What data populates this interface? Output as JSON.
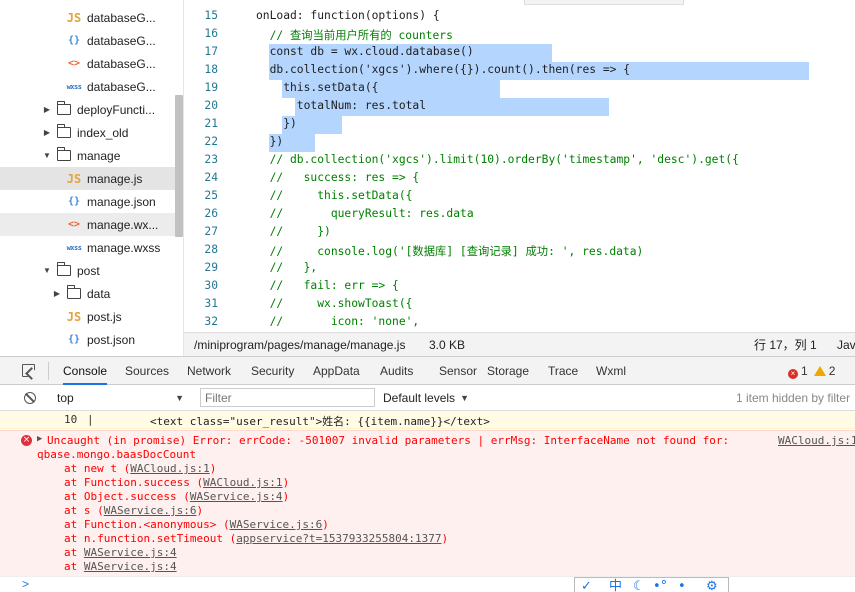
{
  "file_tree": {
    "items": [
      {
        "type": "js",
        "icon": "js-file-icon",
        "label": "databaseG..."
      },
      {
        "type": "json",
        "icon": "json-file-icon",
        "label": "databaseG..."
      },
      {
        "type": "wxml",
        "icon": "wxml-file-icon",
        "label": "databaseG..."
      },
      {
        "type": "wxss",
        "icon": "wxss-file-icon",
        "label": "databaseG..."
      },
      {
        "type": "folder",
        "state": "collapsed",
        "label": "deployFuncti..."
      },
      {
        "type": "folder",
        "state": "collapsed",
        "label": "index_old"
      },
      {
        "type": "folder",
        "state": "expanded",
        "label": "manage"
      },
      {
        "type": "js",
        "icon": "js-file-icon",
        "label": "manage.js",
        "selected": true
      },
      {
        "type": "json",
        "icon": "json-file-icon",
        "label": "manage.json"
      },
      {
        "type": "wxml",
        "icon": "wxml-file-icon",
        "label": "manage.wx..."
      },
      {
        "type": "wxss",
        "icon": "wxss-file-icon",
        "label": "manage.wxss"
      },
      {
        "type": "folder",
        "state": "expanded",
        "label": "post"
      },
      {
        "type": "folder",
        "state": "collapsed",
        "label": "data"
      },
      {
        "type": "js",
        "icon": "js-file-icon",
        "label": "post.js"
      },
      {
        "type": "json",
        "icon": "json-file-icon",
        "label": "post.json"
      }
    ],
    "icon_glyphs": {
      "js": "JS",
      "json": "{}",
      "wxml": "<>",
      "wxss": "wxss"
    }
  },
  "editor": {
    "line_numbers": [
      "15",
      "16",
      "17",
      "18",
      "19",
      "20",
      "21",
      "22",
      "23",
      "24",
      "25",
      "26",
      "27",
      "28",
      "29",
      "30",
      "31",
      "32"
    ],
    "lines": [
      "onLoad: function(options) {",
      "  // 查询当前用户所有的 counters",
      "  const db = wx.cloud.database()",
      "  db.collection('xgcs').where({}).count().then(res => {",
      "    this.setData({",
      "      totalNum: res.total",
      "    })",
      "  })",
      "  // db.collection('xgcs').limit(10).orderBy('timestamp', 'desc').get({",
      "  //   success: res => {",
      "  //     this.setData({",
      "  //       queryResult: res.data",
      "  //     })",
      "  //     console.log('[数据库] [查询记录] 成功: ', res.data)",
      "  //   },",
      "  //   fail: err => {",
      "  //     wx.showToast({",
      "  //       icon: 'none',"
    ]
  },
  "statusbar": {
    "path": "/miniprogram/pages/manage/manage.js",
    "size": "3.0 KB",
    "cursor": "行 17，列 1",
    "language": "Jav"
  },
  "devtools": {
    "tabs": [
      "Console",
      "Sources",
      "Network",
      "Security",
      "AppData",
      "Audits",
      "Sensor",
      "Storage",
      "Trace",
      "Wxml"
    ],
    "active_tab": "Console",
    "error_count": "1",
    "warning_count": "2",
    "context": "top",
    "filter_placeholder": "Filter",
    "levels": "Default levels",
    "hidden_info": "1 item hidden by filter",
    "log": {
      "line_number": "10",
      "separator": "|",
      "text": "<text class=\"user_result\">姓名: {{item.name}}</text>"
    },
    "error": {
      "message_line1": "Uncaught (in promise) Error: errCode: -501007 invalid parameters | errMsg: InterfaceName not found for:",
      "message_line2": "qbase.mongo.baasDocCount",
      "source": "WACloud.js:1",
      "stack": [
        {
          "prefix": "at new t (",
          "link": "WACloud.js:1",
          "suffix": ")"
        },
        {
          "prefix": "at Function.success (",
          "link": "WACloud.js:1",
          "suffix": ")"
        },
        {
          "prefix": "at Object.success (",
          "link": "WAService.js:4",
          "suffix": ")"
        },
        {
          "prefix": "at s (",
          "link": "WAService.js:6",
          "suffix": ")"
        },
        {
          "prefix": "at Function.<anonymous> (",
          "link": "WAService.js:6",
          "suffix": ")"
        },
        {
          "prefix": "at n.function.setTimeout (",
          "link": "appservice?t=1537933255804:1377",
          "suffix": ")"
        },
        {
          "prefix": "at ",
          "link": "WAService.js:4",
          "suffix": ""
        },
        {
          "prefix": "at ",
          "link": "WAService.js:4",
          "suffix": ""
        }
      ]
    },
    "prompt_caret": ">",
    "ime_icons": [
      "✓",
      "中",
      "☾",
      "•°",
      "•",
      "⚙"
    ]
  }
}
